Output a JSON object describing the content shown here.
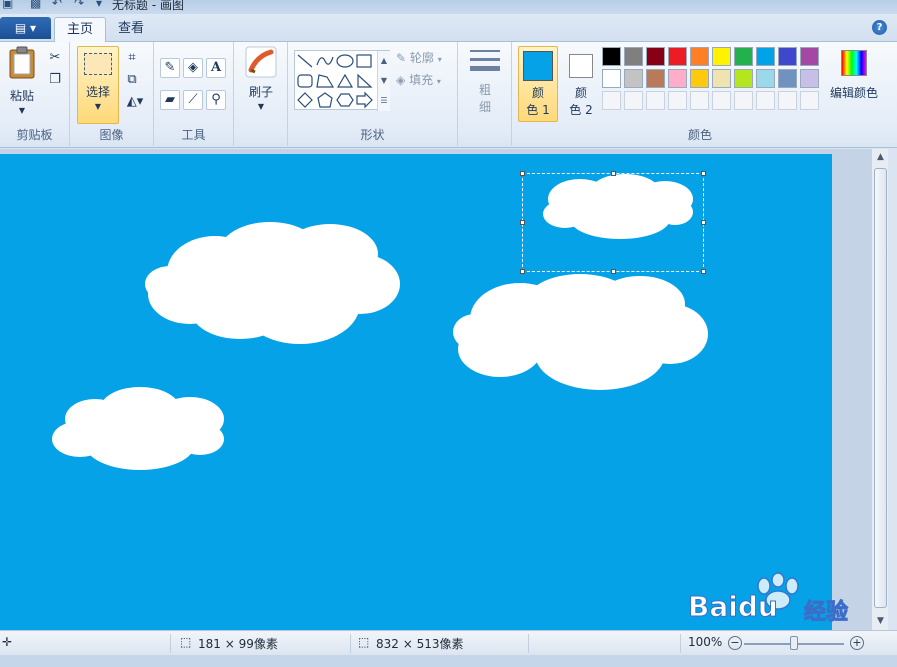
{
  "window": {
    "title": "无标题 - 画图"
  },
  "tabs": [
    {
      "label": "主页",
      "active": true
    },
    {
      "label": "查看",
      "active": false
    }
  ],
  "ribbon": {
    "clipboard": {
      "paste_label": "粘贴",
      "group_label": "剪贴板"
    },
    "image": {
      "select_label": "选择",
      "group_label": "图像"
    },
    "tools": {
      "group_label": "工具"
    },
    "brushes": {
      "label": "刷子"
    },
    "shapes": {
      "outline_label": "轮廓",
      "fill_label": "填充",
      "group_label": "形状"
    },
    "size": {
      "label_line1": "粗",
      "label_line2": "细"
    },
    "colors": {
      "color1_label_line1": "颜",
      "color1_label_line2": "色 1",
      "color2_label_line1": "颜",
      "color2_label_line2": "色 2",
      "color1_value": "#06a2e8",
      "color2_value": "#ffffff",
      "edit_label": "编辑颜色",
      "group_label": "颜色",
      "palette_row1": [
        "#000000",
        "#7f7f7f",
        "#880015",
        "#ed1c24",
        "#ff7f27",
        "#fff200",
        "#22b14c",
        "#00a2e8",
        "#3f48cc",
        "#a349a4"
      ],
      "palette_row2": [
        "#ffffff",
        "#c3c3c3",
        "#b97a57",
        "#ffaec9",
        "#ffc90e",
        "#efe4b0",
        "#b5e61d",
        "#99d9ea",
        "#7092be",
        "#c8bfe7"
      ]
    }
  },
  "canvas": {
    "background": "#06a2e8"
  },
  "statusbar": {
    "selection_size": "181 × 99像素",
    "image_size": "832 × 513像素",
    "zoom": "100%"
  },
  "watermark": {
    "brand": "Bai",
    "brand2": "du",
    "suffix": "经验"
  }
}
